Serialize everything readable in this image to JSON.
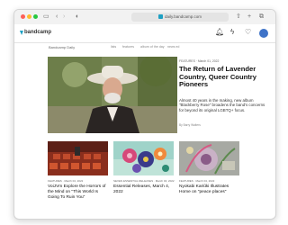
{
  "browser": {
    "url": "daily.bandcamp.com",
    "colors": {
      "close": "#fd5f57",
      "minimize": "#febc2e",
      "zoom": "#28c840"
    },
    "icons": [
      "sidebar-icon",
      "back-icon",
      "forward-icon",
      "shield-icon",
      "share-icon",
      "new-tab-icon",
      "tabs-overview-icon"
    ]
  },
  "site": {
    "logo_text": "bandcamp",
    "brand_color": "#1da0c3",
    "daily_label": "Bandcamp Daily",
    "nav": [
      "lists",
      "features",
      "album of the day",
      "news ed"
    ]
  },
  "hero": {
    "meta": "FEATURES · March 01, 2022",
    "title": "The Return of Lavender Country, Queer Country Pioneers",
    "description": "Almost 40 years in the making, new album \"Blackberry Rose\" broadens the band's concerns for beyond its original LGBTQ+ focus.",
    "byline": "By Barry Walters"
  },
  "cards": [
    {
      "meta": "FEATURES · March 04, 2022",
      "title": "VoiJVm Explore the Horrors of the Mind on \"This World Is Going To Ruin You\""
    },
    {
      "meta": "SEVEN ESSENTIAL RELEASES · March 04, 2022",
      "title": "Essential Releases, March 4, 2022"
    },
    {
      "meta": "FEATURES · March 04, 2022",
      "title": "Nyokabi Kariũki Illustrates Home on \"peace places\""
    }
  ]
}
